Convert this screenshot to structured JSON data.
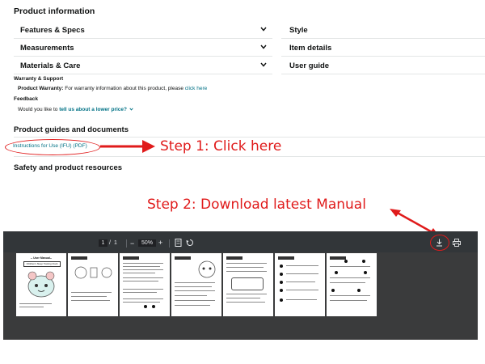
{
  "product_info": {
    "title": "Product information",
    "left_rows": [
      "Features & Specs",
      "Measurements",
      "Materials & Care"
    ],
    "right_rows": [
      "Style",
      "Item details",
      "User guide"
    ]
  },
  "warranty": {
    "title": "Warranty & Support",
    "label": "Product Warranty:",
    "text": " For warranty information about this product, please ",
    "link": "click here"
  },
  "feedback": {
    "title": "Feedback",
    "text": "Would you like to ",
    "link": "tell us about a lower price?"
  },
  "guides": {
    "title": "Product guides and documents",
    "link": "Instructions for Use (IFU) (PDF)"
  },
  "safety": {
    "title": "Safety and product resources"
  },
  "annotations": {
    "step1": "Step 1: Click here",
    "step2": "Step 2: Download latest Manual",
    "color": "#e01b1b"
  },
  "viewer": {
    "page_current": "1",
    "page_sep": "/",
    "page_total": "1",
    "zoom_minus": "−",
    "zoom": "50%",
    "zoom_plus": "+",
    "icons": [
      "fit-page-icon",
      "rotate-icon",
      "download-icon",
      "print-icon"
    ],
    "page1_title": "-- User Manual--",
    "page1_subtitle": "Children's Sleep Training Clock"
  }
}
